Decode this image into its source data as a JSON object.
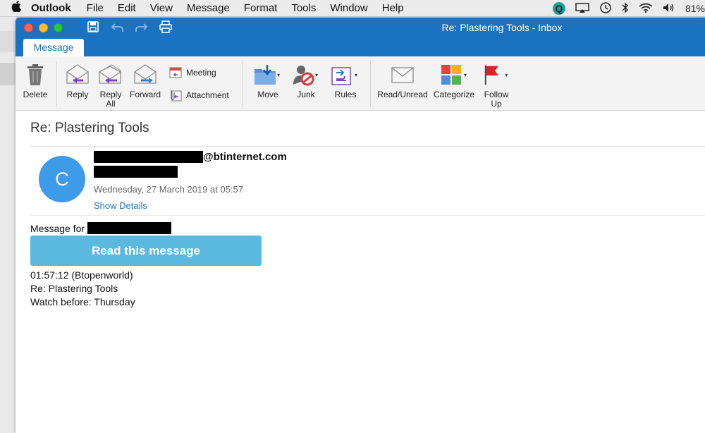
{
  "menubar": {
    "app_name": "Outlook",
    "items": [
      "File",
      "Edit",
      "View",
      "Message",
      "Format",
      "Tools",
      "Window",
      "Help"
    ],
    "battery": "81%"
  },
  "window": {
    "title": "Re: Plastering Tools - Inbox",
    "active_tab": "Message"
  },
  "ribbon": {
    "delete": "Delete",
    "reply": "Reply",
    "reply_all": "Reply\nAll",
    "forward": "Forward",
    "meeting": "Meeting",
    "attachment": "Attachment",
    "move": "Move",
    "junk": "Junk",
    "rules": "Rules",
    "read_unread": "Read/Unread",
    "categorize": "Categorize",
    "follow_up": "Follow\nUp"
  },
  "message": {
    "subject": "Re: Plastering Tools",
    "avatar_initial": "C",
    "from_domain": "@btinternet.com",
    "date": "Wednesday, 27 March 2019 at 05:57",
    "show_details": "Show Details",
    "message_for": "Message for",
    "read_button": "Read this message",
    "body_lines": [
      "01:57:12 (Btopenworld)",
      "Re: Plastering Tools",
      "Watch before: Thursday"
    ]
  },
  "colors": {
    "titlebar": "#1b72c0",
    "accent_link": "#1b72c0",
    "read_button": "#5bb9e0",
    "avatar": "#3d9be9"
  }
}
